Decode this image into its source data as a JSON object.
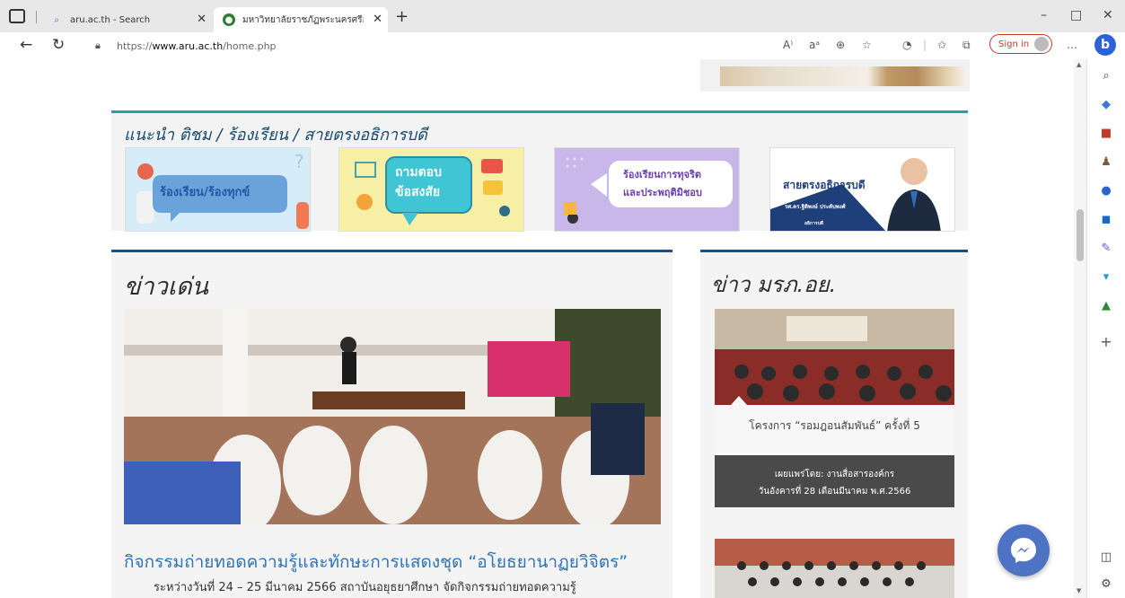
{
  "browser": {
    "tabs": [
      {
        "title": "aru.ac.th - Search",
        "active": false,
        "favicon": "search-icon"
      },
      {
        "title": "มหาวิทยาลัยราชภัฏพระนครศรีอยุธยา",
        "active": true,
        "favicon": "university-logo-icon"
      }
    ],
    "url": {
      "proto": "https://",
      "host": "www.aru.ac.th",
      "path": "/home.php"
    },
    "toolbar": {
      "read_aloud": "A⁾",
      "translate": "aᵃ",
      "signin_label": "Sign in",
      "more": "…"
    },
    "window_controls": {
      "minimize": "–",
      "restore": "□",
      "close": "✕"
    }
  },
  "page": {
    "recommend": {
      "title": "แนะนำ ติชม / ร้องเรียน / สายตรงอธิการบดี",
      "cards": [
        {
          "label": "ร้องเรียน/ร้องทุกข์"
        },
        {
          "label": "ถามตอบ ข้อสงสัย",
          "line1": "ถามตอบ",
          "line2": "ข้อสงสัย"
        },
        {
          "label": "ร้องเรียนการทุจริต และประพฤติมิชอบ",
          "line1": "ร้องเรียนการทุจริต",
          "line2": "และประพฤติมิชอบ"
        },
        {
          "label": "สายตรงอธิการบดี",
          "name": "รศ.ดร.ฐิติพงษ์ ประดับพงศ์",
          "role": "อธิการบดี"
        }
      ]
    },
    "highlight": {
      "heading": "ข่าวเด่น",
      "title": "กิจกรรมถ่ายทอดความรู้และทักษะการแสดงชุด “อโยธยานาฏยวิจิตร”",
      "summary": "ระหว่างวันที่ 24 – 25 มีนาคม 2566 สถาบันอยุธยาศึกษา จัดกิจกรรมถ่ายทอดความรู้"
    },
    "news": {
      "heading": "ข่าว มรภ.อย.",
      "item1_caption": "โครงการ “รอมฎอนสัมพันธ์” ครั้งที่ 5",
      "item1_publisher": "เผยแพร่โดย: งานสื่อสารองค์กร",
      "item1_date": "วันอังคารที่ 28 เดือนมีนาคม พ.ศ.2566"
    }
  }
}
